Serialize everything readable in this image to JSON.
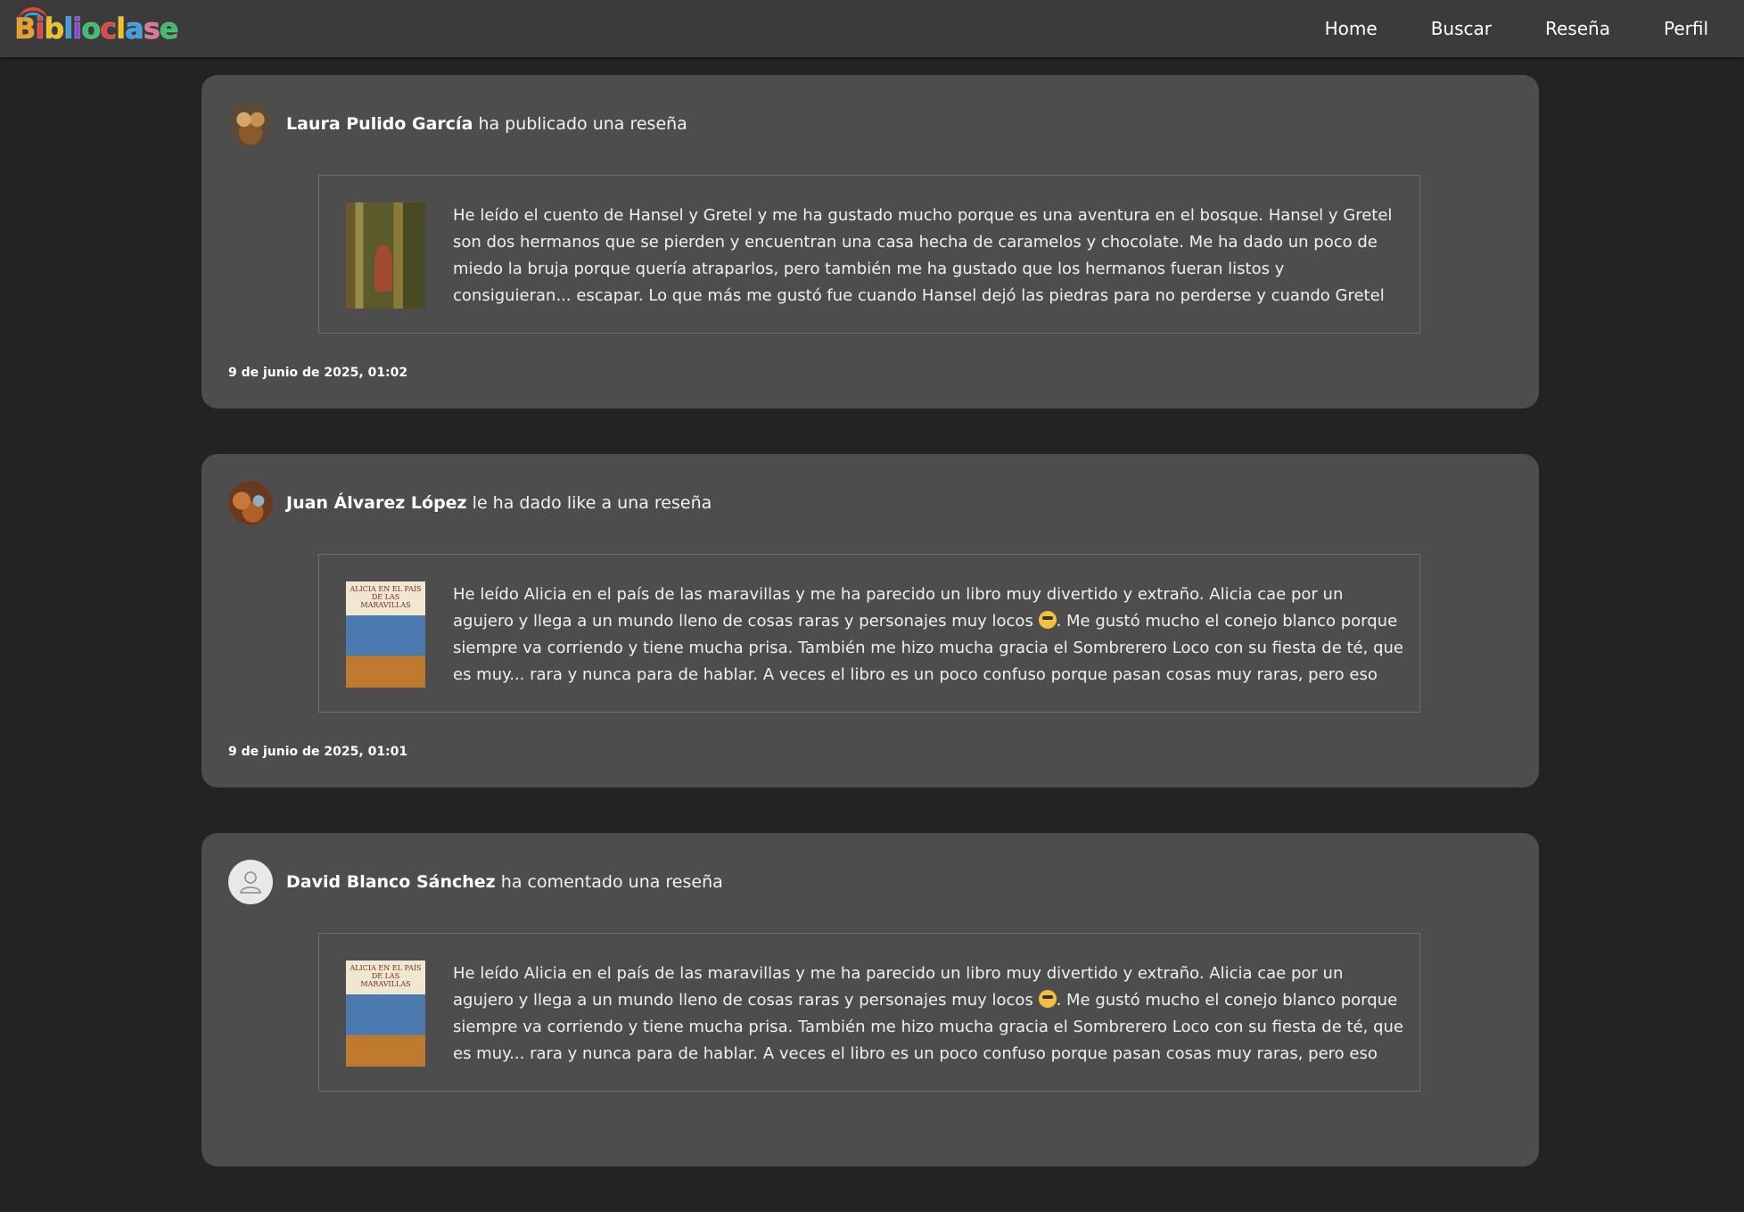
{
  "header": {
    "logo_text": "Biblioclase",
    "nav": [
      "Home",
      "Buscar",
      "Reseña",
      "Perfil"
    ]
  },
  "feed": [
    {
      "user": "Laura Pulido García",
      "action": "ha publicado una reseña",
      "book_cover": "Hansel y Gretel",
      "review": "He leído el cuento de Hansel y Gretel y me ha gustado mucho porque es una aventura en el bosque. Hansel y Gretel son dos hermanos que se pierden y encuentran una casa hecha de caramelos y chocolate. Me ha dado un poco de miedo la bruja porque quería atraparlos, pero también me ha gustado que los hermanos fueran listos y consiguieran... escapar. Lo que más me gustó fue cuando Hansel dejó las piedras para no perderse y cuando Gretel empujó a la bruja",
      "date": "9 de junio de 2025, 01:02"
    },
    {
      "user": "Juan Álvarez López",
      "action": "le ha dado like a una reseña",
      "book_cover": "ALICIA EN EL PAÍS DE LAS MARAVILLAS",
      "review_part1": "He leído Alicia en el país de las maravillas y me ha parecido un libro muy divertido y extraño. Alicia cae por un agujero y llega a un mundo lleno de cosas raras y personajes muy locos",
      "review_part2": ". Me gustó mucho el conejo blanco porque siempre va corriendo y tiene mucha prisa. También me hizo mucha gracia el Sombrerero Loco con su fiesta de té, que es muy... rara y nunca para de hablar. A veces el libro es un poco confuso porque pasan cosas muy raras, pero eso me gustó",
      "date": "9 de junio de 2025, 01:01"
    },
    {
      "user": "David Blanco Sánchez",
      "action": "ha comentado una reseña",
      "book_cover": "ALICIA EN EL PAÍS DE LAS MARAVILLAS",
      "review_part1": "He leído Alicia en el país de las maravillas y me ha parecido un libro muy divertido y extraño. Alicia cae por un agujero y llega a un mundo lleno de cosas raras y personajes muy locos",
      "review_part2": ". Me gustó mucho el conejo blanco porque siempre va corriendo y tiene mucha prisa. También me hizo mucha gracia el Sombrerero Loco con su fiesta de té, que es muy... rara y nunca para de hablar. A veces el libro es un poco confuso porque pasan cosas muy raras, pero eso me gustó"
    }
  ],
  "colors": {
    "background": "#232323",
    "topbar": "#3b3b3b",
    "card": "#4d4d4d"
  }
}
